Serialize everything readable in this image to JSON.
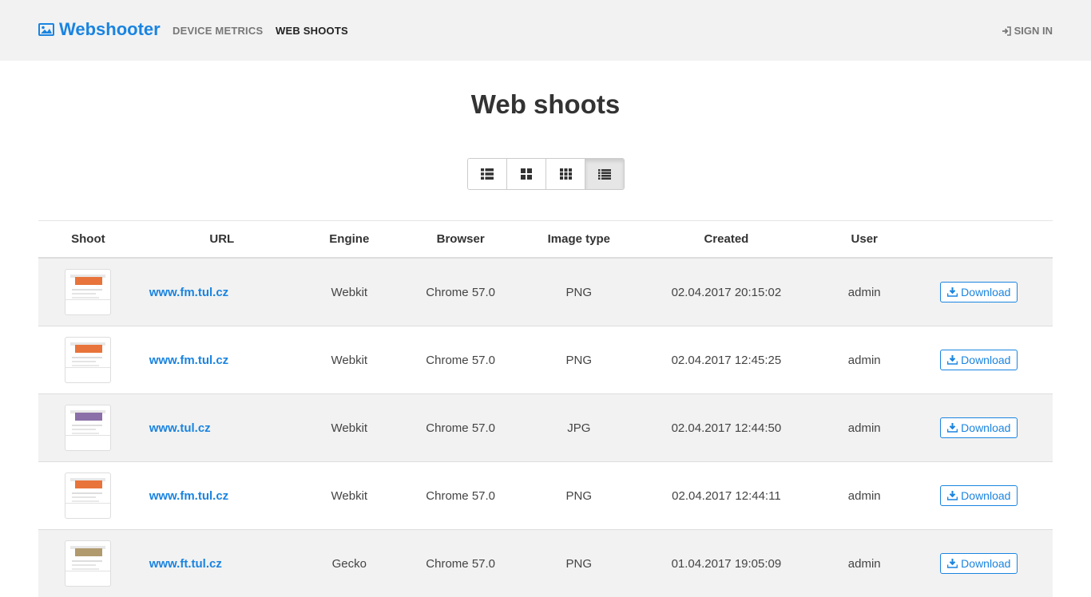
{
  "nav": {
    "brand": "Webshooter",
    "links": [
      "DEVICE METRICS",
      "WEB SHOOTS"
    ],
    "signin": "SIGN IN"
  },
  "page": {
    "title": "Web shoots"
  },
  "view_modes": [
    "list-thumbnails-icon",
    "grid-large-icon",
    "grid-small-icon",
    "list-icon"
  ],
  "table": {
    "headers": [
      "Shoot",
      "URL",
      "Engine",
      "Browser",
      "Image type",
      "Created",
      "User",
      ""
    ],
    "rows": [
      {
        "url": "www.fm.tul.cz",
        "engine": "Webkit",
        "browser": "Chrome 57.0",
        "type": "PNG",
        "created": "02.04.2017 20:15:02",
        "user": "admin",
        "action": "Download"
      },
      {
        "url": "www.fm.tul.cz",
        "engine": "Webkit",
        "browser": "Chrome 57.0",
        "type": "PNG",
        "created": "02.04.2017 12:45:25",
        "user": "admin",
        "action": "Download"
      },
      {
        "url": "www.tul.cz",
        "engine": "Webkit",
        "browser": "Chrome 57.0",
        "type": "JPG",
        "created": "02.04.2017 12:44:50",
        "user": "admin",
        "action": "Download"
      },
      {
        "url": "www.fm.tul.cz",
        "engine": "Webkit",
        "browser": "Chrome 57.0",
        "type": "PNG",
        "created": "02.04.2017 12:44:11",
        "user": "admin",
        "action": "Download"
      },
      {
        "url": "www.ft.tul.cz",
        "engine": "Gecko",
        "browser": "Chrome 57.0",
        "type": "PNG",
        "created": "01.04.2017 19:05:09",
        "user": "admin",
        "action": "Download"
      }
    ]
  },
  "colors": {
    "accent": "#1a84e0",
    "navbar_bg": "#f2f2f3",
    "stripe": "#f2f2f2",
    "thumb_hero": [
      "#e8743b",
      "#e8743b",
      "#8a6fa8",
      "#e8743b",
      "#b09a6e"
    ]
  }
}
